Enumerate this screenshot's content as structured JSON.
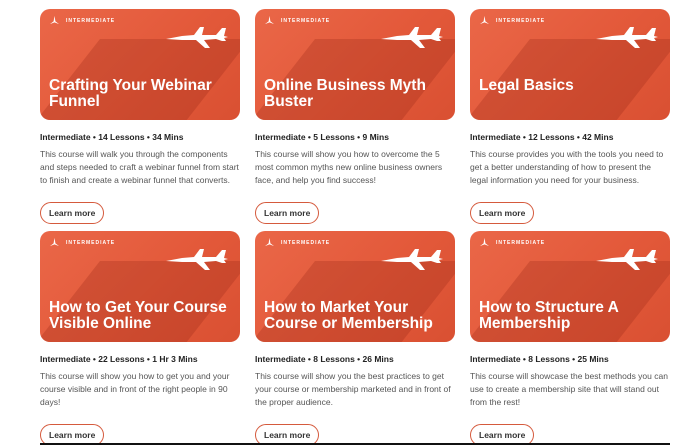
{
  "badge_label": "INTERMEDIATE",
  "button_label": "Learn more",
  "colors": {
    "accent": "#e3593a",
    "button_border": "#d55a3d"
  },
  "courses": [
    {
      "title": "Crafting Your Webinar Funnel",
      "meta": "Intermediate • 14 Lessons • 34 Mins",
      "description": "This course will walk you through the components and steps needed to craft a webinar funnel from start to finish and create a webinar funnel that converts."
    },
    {
      "title": "Online Business Myth Buster",
      "meta": "Intermediate • 5 Lessons • 9 Mins",
      "description": "This course will show you how to overcome the 5 most common myths new online business owners face, and help you find success!"
    },
    {
      "title": "Legal Basics",
      "meta": "Intermediate • 12 Lessons • 42 Mins",
      "description": "This course provides you with the tools you need to get a better understanding of how to present the legal information you need for your business."
    },
    {
      "title": "How to Get Your Course Visible Online",
      "meta": "Intermediate • 22 Lessons • 1 Hr 3 Mins",
      "description": "This course will show you how to get you and your course visible and in front of the right people in 90 days!"
    },
    {
      "title": "How to Market Your Course or Membership",
      "meta": "Intermediate • 8 Lessons • 26 Mins",
      "description": "This course will show you the best practices to get your course or membership marketed and in front of the proper audience."
    },
    {
      "title": "How to Structure A Membership",
      "meta": "Intermediate • 8 Lessons • 25 Mins",
      "description": "This course will showcase the best methods you can use to create a membership site that will stand out from the rest!"
    }
  ]
}
